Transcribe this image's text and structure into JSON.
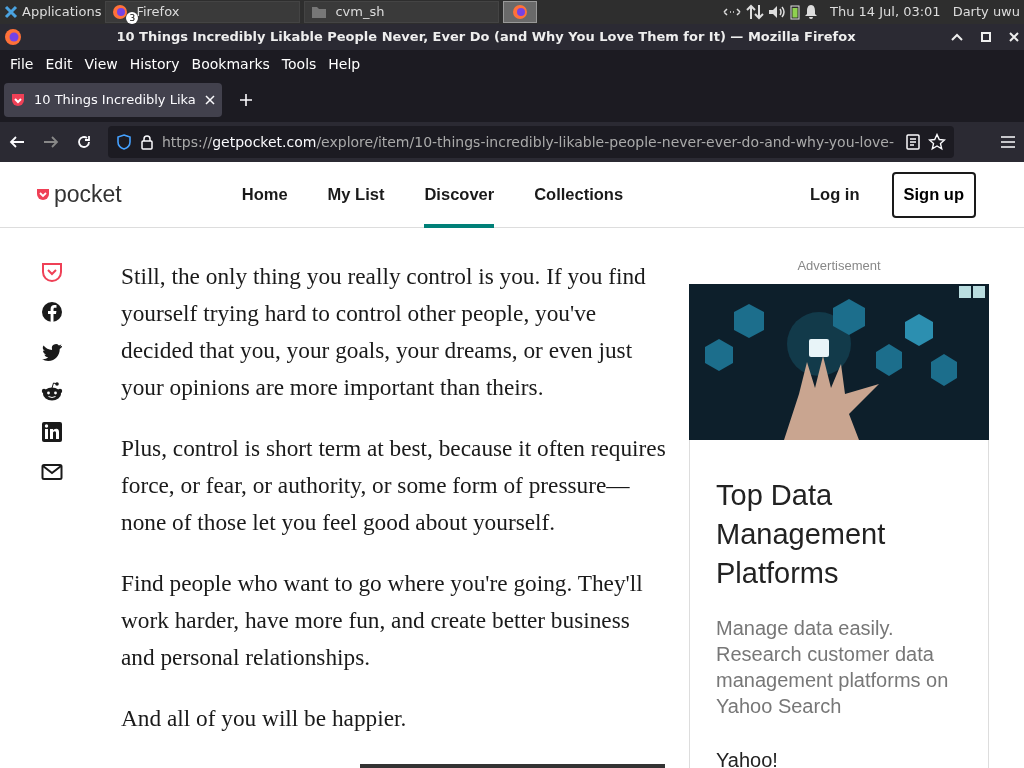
{
  "taskbar": {
    "apps_menu": "Applications",
    "tasks": [
      {
        "kind": "browser",
        "label": "Firefox",
        "badge": "3",
        "selected": false
      },
      {
        "kind": "folder",
        "label": "cvm_sh",
        "selected": false
      },
      {
        "kind": "icon",
        "selected": true
      }
    ],
    "clock": "Thu 14 Jul, 03:01",
    "user": "Darty uwu"
  },
  "window": {
    "title": "10 Things Incredibly Likable People Never, Ever Do (and Why You Love Them for It) — Mozilla Firefox"
  },
  "menu": [
    "File",
    "Edit",
    "View",
    "History",
    "Bookmarks",
    "Tools",
    "Help"
  ],
  "tabs": [
    {
      "label": "10 Things Incredibly Lika",
      "selected": true
    }
  ],
  "url": {
    "scheme": "https://",
    "host": "getpocket.com",
    "path": "/explore/item/10-things-incredibly-likable-people-never-ever-do-and-why-you-love-"
  },
  "site": {
    "logo": "pocket",
    "nav": [
      {
        "label": "Home",
        "selected": false
      },
      {
        "label": "My List",
        "selected": false
      },
      {
        "label": "Discover",
        "selected": true
      },
      {
        "label": "Collections",
        "selected": false
      }
    ],
    "login": "Log in",
    "signup": "Sign up"
  },
  "share": [
    {
      "kind": "pocket"
    },
    {
      "kind": "facebook"
    },
    {
      "kind": "twitter"
    },
    {
      "kind": "reddit"
    },
    {
      "kind": "linkedin"
    },
    {
      "kind": "email"
    }
  ],
  "paragraphs": [
    "Still, the only thing you really control is you. If you find yourself trying hard to control other people, you've decided that you, your goals, your dreams, or even just your opinions are more important than theirs.",
    "Plus, control is short term at best, because it often requires force, or fear, or authority, or some form of pressure—none of those let you feel good about yourself.",
    "Find people who want to go where you're going. They'll work harder, have more fun, and create better business and personal relationships.",
    "And all of you will be happier."
  ],
  "ad": {
    "label": "Advertisement",
    "headline": "Top Data Management Platforms",
    "body": "Manage data easily. Research customer data management platforms on Yahoo Search",
    "advertiser": "Yahoo!"
  }
}
